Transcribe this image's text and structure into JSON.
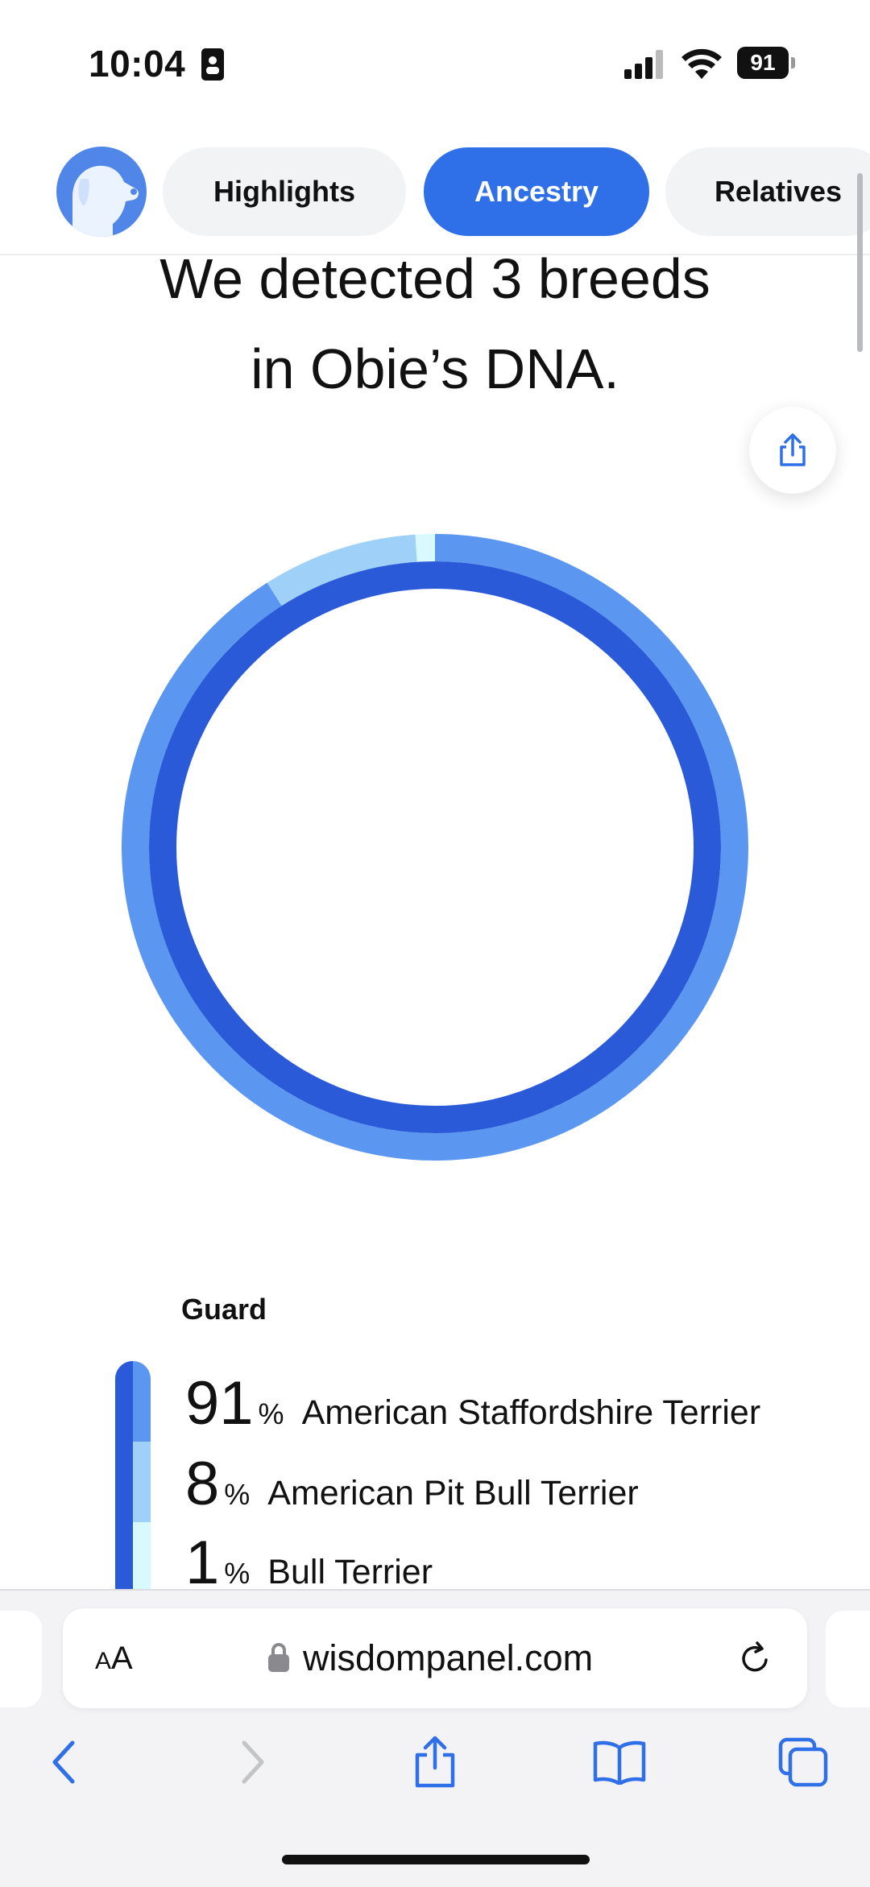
{
  "status_bar": {
    "time": "10:04",
    "battery_level": "91"
  },
  "tabs": [
    {
      "label": "Highlights",
      "active": false
    },
    {
      "label": "Ancestry",
      "active": true
    },
    {
      "label": "Relatives",
      "active": false
    }
  ],
  "headline": {
    "line1": "We detected 3 breeds",
    "line2": "in Obie’s DNA."
  },
  "colors": {
    "accent": "#2f6fe8",
    "breed_1": "#2a5ad8",
    "breed_2": "#9fd0f8",
    "breed_3": "#d8faff",
    "outer_ring": "#5b97f0"
  },
  "breakdown": {
    "group_label": "Guard",
    "breeds": [
      {
        "percent": "91",
        "symbol": "%",
        "name": "American Staffordshire Terrier",
        "fraction": 0.91
      },
      {
        "percent": "8",
        "symbol": "%",
        "name": "American Pit Bull Terrier",
        "fraction": 0.08
      },
      {
        "percent": "1",
        "symbol": "%",
        "name": "Bull Terrier",
        "fraction": 0.01
      }
    ]
  },
  "browser": {
    "text_size_label_small": "A",
    "text_size_label_large": "A",
    "url": "wisdompanel.com"
  },
  "icons": {
    "avatar": "dog-silhouette-icon",
    "share": "share-icon",
    "lock": "lock-icon",
    "reload": "reload-icon",
    "back": "chevron-left-icon",
    "forward": "chevron-right-icon",
    "bookmarks": "book-icon",
    "tabs": "tabs-icon"
  }
}
